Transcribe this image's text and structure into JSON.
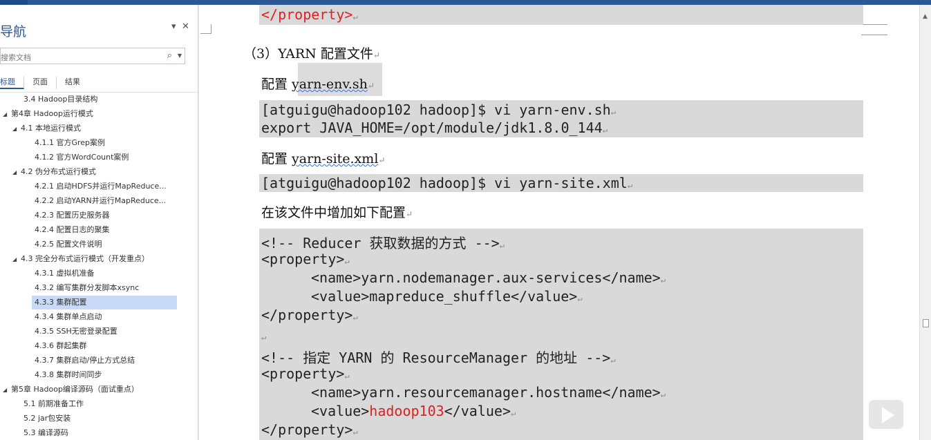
{
  "nav": {
    "title": "导航",
    "search_placeholder": "搜索文档",
    "tabs": [
      "标题",
      "页面",
      "结果"
    ],
    "items": [
      {
        "text": "3.4 Hadoop目录结构"
      },
      {
        "text": "第4章 Hadoop运行模式"
      },
      {
        "text": "4.1 本地运行模式"
      },
      {
        "text": "4.1.1 官方Grep案例"
      },
      {
        "text": "4.1.2 官方WordCount案例"
      },
      {
        "text": "4.2 伪分布式运行模式"
      },
      {
        "text": "4.2.1 启动HDFS并运行MapReduce..."
      },
      {
        "text": "4.2.2 启动YARN并运行MapReduce..."
      },
      {
        "text": "4.2.3 配置历史服务器"
      },
      {
        "text": "4.2.4 配置日志的聚集"
      },
      {
        "text": "4.2.5 配置文件说明"
      },
      {
        "text": "4.3 完全分布式运行模式（开发重点）"
      },
      {
        "text": "4.3.1 虚拟机准备"
      },
      {
        "text": "4.3.2 编写集群分发脚本xsync"
      },
      {
        "text": "4.3.3 集群配置"
      },
      {
        "text": "4.3.4 集群单点启动"
      },
      {
        "text": "4.3.5 SSH无密登录配置"
      },
      {
        "text": "4.3.6 群起集群"
      },
      {
        "text": "4.3.7 集群启动/停止方式总结"
      },
      {
        "text": "4.3.8 集群时间同步"
      },
      {
        "text": "第5章 Hadoop编译源码（面试重点）"
      },
      {
        "text": "5.1 前期准备工作"
      },
      {
        "text": "5.2 jar包安装"
      },
      {
        "text": "5.3 编译源码"
      }
    ]
  },
  "doc": {
    "top_line": "</property>",
    "section_heading": "（3）YARN 配置文件",
    "config1_prefix": "配置 ",
    "config1_file": "yarn-env.sh",
    "cmd1_prompt": "[atguigu@hadoop102 hadoop]$ vi yarn-env.sh",
    "cmd1_export": "export JAVA_HOME=/opt/module/jdk1.8.0_144",
    "config2_prefix": "配置 ",
    "config2_file": "yarn-site.xml",
    "cmd2_prompt": "[atguigu@hadoop102 hadoop]$ vi yarn-site.xml",
    "add_config_text": "在该文件中增加如下配置",
    "code": {
      "comment1": "<!-- Reducer 获取数据的方式 -->",
      "prop_open1": "<property>",
      "name1": "<name>yarn.nodemanager.aux-services</name>",
      "value1": "<value>mapreduce_shuffle</value>",
      "prop_close1": "</property>",
      "comment2": "<!-- 指定 YARN 的 ResourceManager 的地址 -->",
      "prop_open2": "<property>",
      "name2": "<name>yarn.resourcemanager.hostname</name>",
      "value2_open": "<value>",
      "value2_host": "hadoop103",
      "value2_close": "</value>",
      "prop_close2": "</property>"
    }
  },
  "colors": {
    "accent": "#2b5797",
    "red_text": "#e02020",
    "code_bg": "#d9d9d9",
    "nav_selected": "#c9daf6"
  }
}
